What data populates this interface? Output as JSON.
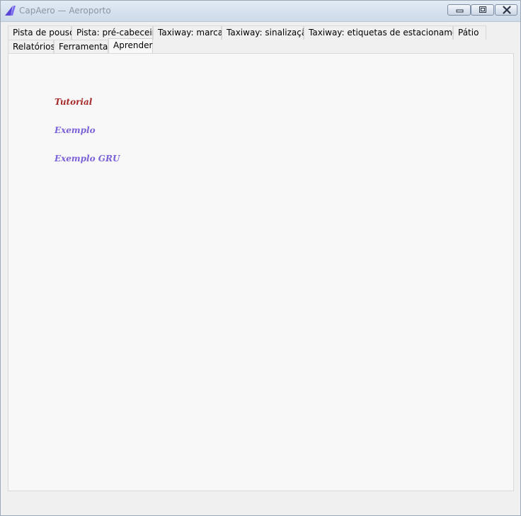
{
  "window": {
    "title": "CapAero — Aeroporto"
  },
  "tabs": {
    "row1": [
      {
        "label": "Pista de pouso"
      },
      {
        "label": "Pista: pré-cabeceira"
      },
      {
        "label": "Taxiway: marcas"
      },
      {
        "label": "Taxiway: sinalização"
      },
      {
        "label": "Taxiway: etiquetas de estacionamento"
      },
      {
        "label": "Pátio"
      }
    ],
    "row2": [
      {
        "label": "Relatórios"
      },
      {
        "label": "Ferramentas"
      },
      {
        "label": "Aprender"
      }
    ],
    "selected": "Aprender"
  },
  "learn": {
    "links": [
      {
        "label": "Tutorial",
        "color": "#a62b2b"
      },
      {
        "label": "Exemplo",
        "color": "#7b62d8"
      },
      {
        "label": "Exemplo GRU",
        "color": "#7b62d8"
      }
    ]
  },
  "colors": {
    "app_icon": "#5a46d6"
  },
  "icons": {
    "app": "capaero-logo-icon",
    "minimize": "minimize-icon",
    "maximize": "maximize-icon",
    "close": "close-icon"
  }
}
